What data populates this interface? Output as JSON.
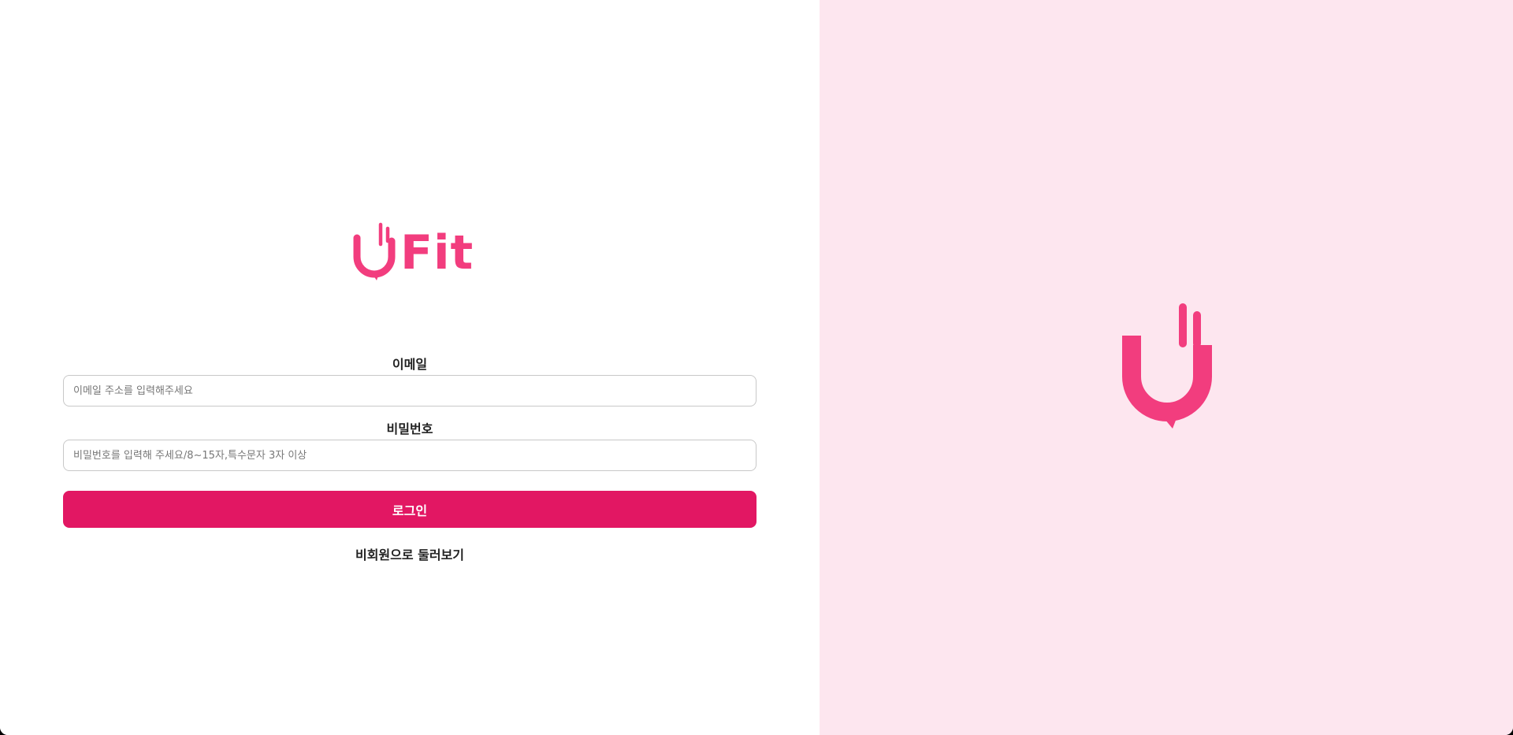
{
  "brand": {
    "name": "Fit",
    "logo_icon": "u-hand-speech-icon",
    "color": "#f23d7e"
  },
  "form": {
    "email_label": "이메일",
    "email_placeholder": "이메일 주소를 입력해주세요",
    "password_label": "비밀번호",
    "password_placeholder": "비밀번호를 입력해 주세요/8~15자,특수문자 3자 이상",
    "login_button": "로그인",
    "guest_link": "비회원으로 둘러보기"
  },
  "colors": {
    "primary_button": "#e21763",
    "right_pane_bg": "#fde6ef",
    "logo": "#f23d7e"
  }
}
